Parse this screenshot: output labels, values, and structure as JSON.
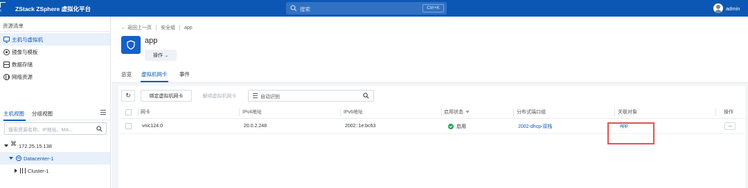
{
  "app": {
    "logo_text": "ck",
    "title": "ZStack ZSphere 虚拟化平台",
    "search_placeholder": "搜索",
    "search_shortcut": "Ctrl+K",
    "username": "admin"
  },
  "sidebar": {
    "heading": "资源清单",
    "items": [
      {
        "label": "主机与虚拟机",
        "icon": "monitor-icon",
        "active": true
      },
      {
        "label": "镜像与模板",
        "icon": "disc-icon",
        "active": false
      },
      {
        "label": "数据存储",
        "icon": "database-icon",
        "active": false
      },
      {
        "label": "网络资源",
        "icon": "globe-icon",
        "active": false
      }
    ],
    "view_tabs": [
      {
        "label": "主机视图",
        "active": true
      },
      {
        "label": "分组视图",
        "active": false
      }
    ],
    "search_placeholder": "搜索资源名称、IP地址、MA...",
    "tree": [
      {
        "label": "172.25.15.138",
        "expanded": true
      },
      {
        "label": "Datacenter-1",
        "expanded": true,
        "active": true
      },
      {
        "label": "Cluster-1",
        "expanded": false
      }
    ]
  },
  "main": {
    "breadcrumb": {
      "back": "返回上一页",
      "items": [
        "安全组",
        "app"
      ]
    },
    "resource_name": "app",
    "ops_label": "操作",
    "tabs": [
      {
        "label": "总览",
        "active": false
      },
      {
        "label": "虚拟机网卡",
        "active": true
      },
      {
        "label": "事件",
        "active": false
      }
    ],
    "toolbar": {
      "bind_label": "绑定虚拟机网卡",
      "unbind_label": "解绑虚拟机网卡",
      "filter_placeholder": "自动识别"
    },
    "table": {
      "columns": [
        "网卡",
        "IPv4地址",
        "IPv6地址",
        "启用状态",
        "分布式端口组",
        "关联对象",
        "操作"
      ],
      "rows": [
        {
          "nic": "vnic124.0",
          "ipv4": "20.0.2.248",
          "ipv6": "2002::1e:bc63",
          "status": "启用",
          "port_group": "2002-dhcp-双栈",
          "related": "app",
          "action": "···"
        }
      ]
    }
  },
  "colors": {
    "topbar": "#0d57b4",
    "accent": "#0d57b4",
    "status_enabled": "#23a455",
    "highlight_box": "#e05252"
  }
}
